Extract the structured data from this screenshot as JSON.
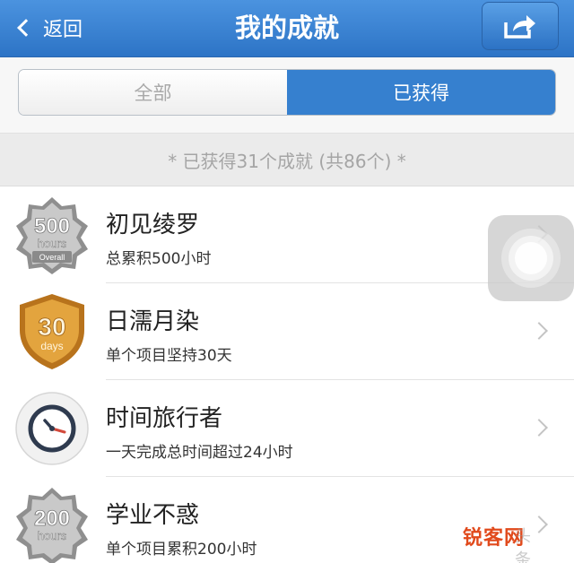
{
  "navbar": {
    "back_label": "返回",
    "title": "我的成就",
    "share_icon": "share-icon"
  },
  "segments": [
    {
      "label": "全部",
      "active": false
    },
    {
      "label": "已获得",
      "active": true
    }
  ],
  "summary": "* 已获得31个成就 (共86个) *",
  "achievements": [
    {
      "name": "初见绫罗",
      "desc": "总累积500小时",
      "badge": "silver-500-hours-badge",
      "badge_text": [
        "500",
        "hours",
        "Overall"
      ]
    },
    {
      "name": "日濡月染",
      "desc": "单个项目坚持30天",
      "badge": "gold-30-days-shield-badge",
      "badge_text": [
        "30",
        "days"
      ]
    },
    {
      "name": "时间旅行者",
      "desc": "一天完成总时间超过24小时",
      "badge": "clock-badge",
      "badge_text": []
    },
    {
      "name": "学业不惑",
      "desc": "单个项目累积200小时",
      "badge": "silver-200-hours-badge",
      "badge_text": [
        "200",
        "hours"
      ]
    }
  ],
  "colors": {
    "nav_blue": "#3680cf",
    "gold": "#d9962f",
    "silver": "#9a9a9a",
    "watermark": "#e14a1c"
  },
  "watermark": {
    "text": "锐客网",
    "faint": "头条 @"
  }
}
